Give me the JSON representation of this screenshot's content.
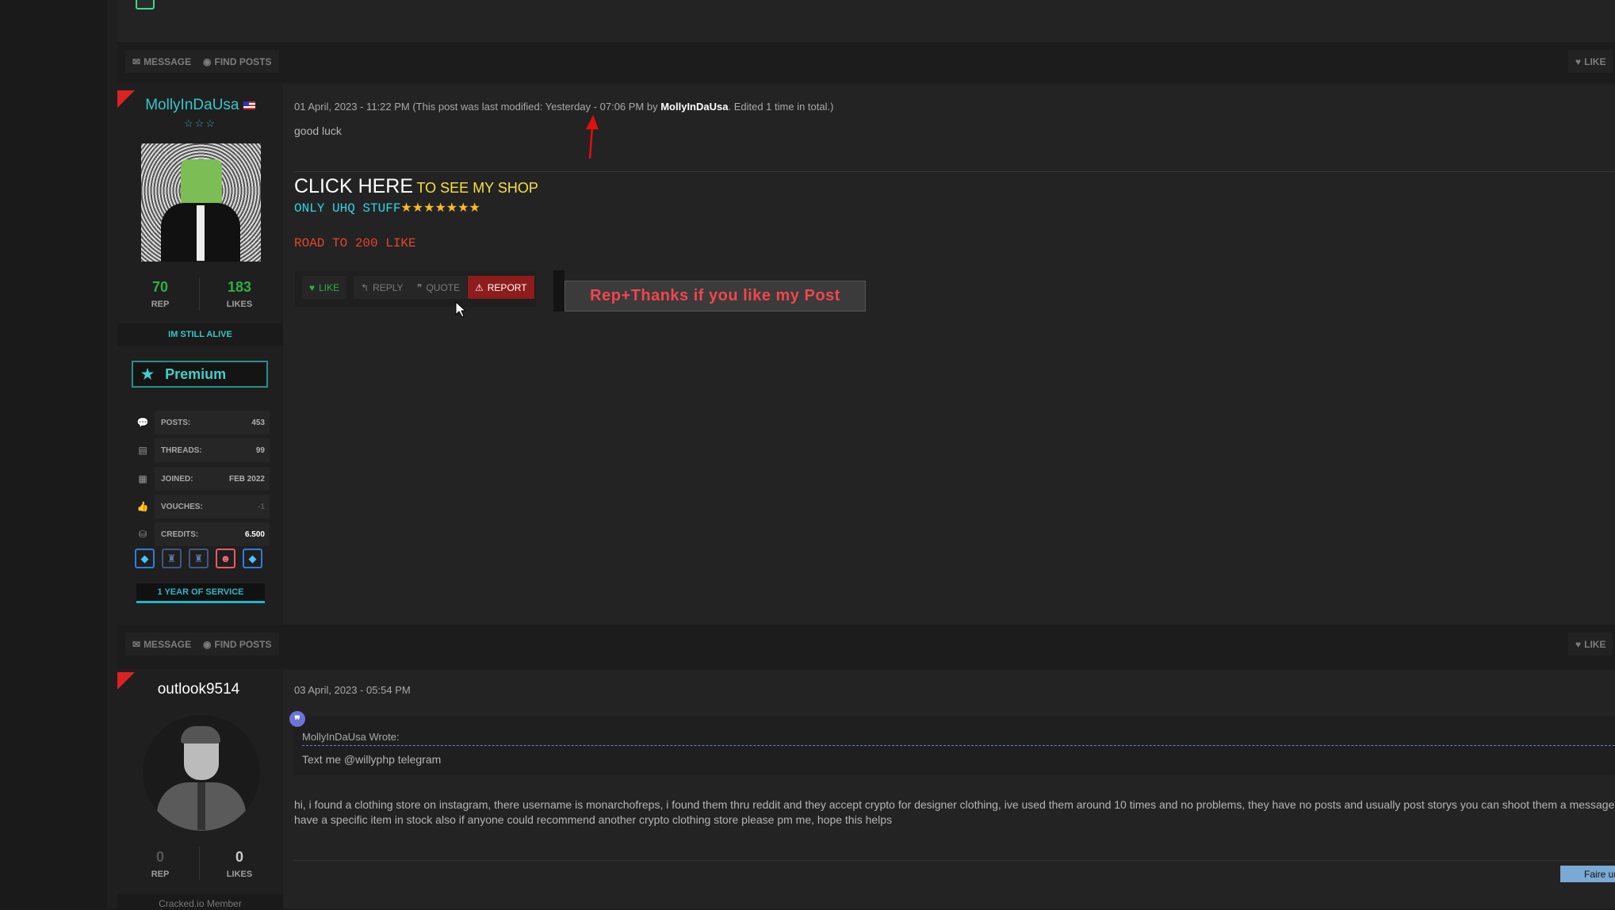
{
  "colors": {
    "accent": "#37c6c9",
    "report": "#8e1c1c",
    "likeGreen": "#2eaf45",
    "premium": "#3fd0c9",
    "fairebtn": "#7aa9d4"
  },
  "post_footer": {
    "message": "MESSAGE",
    "find_posts": "FIND POSTS",
    "like": "LIKE"
  },
  "post1": {
    "username": "MollyInDaUsa",
    "flag": "us-flag-icon",
    "rep": "70",
    "rep_label": "REP",
    "likes": "183",
    "likes_label": "LIKES",
    "title": "IM STILL ALIVE",
    "rank": "Premium",
    "stats": [
      {
        "icon": "comments-icon",
        "key": "POSTS:",
        "value": "453"
      },
      {
        "icon": "book-icon",
        "key": "THREADS:",
        "value": "99"
      },
      {
        "icon": "calendar-icon",
        "key": "JOINED:",
        "value": "FEB 2022"
      },
      {
        "icon": "thumbs-up-icon",
        "key": "VOUCHES:",
        "value": "-1"
      },
      {
        "icon": "coins-icon",
        "key": "CREDITS:",
        "value": "6.500"
      }
    ],
    "service": "1 YEAR OF SERVICE",
    "meta_prefix": "01 April, 2023 - 11:22 PM (This post was last modified: Yesterday - 07:06 PM by ",
    "meta_user": "MollyInDaUsa",
    "meta_suffix": ". Edited 1 time in total.)",
    "body": "good luck",
    "sig_click": "CLICK HERE",
    "sig_shop": "TO SEE MY SHOP",
    "sig_uhq": "ONLY UHQ STUFF",
    "sig_stars": "★★★★★★★",
    "sig_road": "ROAD TO 200 LIKE",
    "actions": {
      "like": "LIKE",
      "reply": "REPLY",
      "quote": "QUOTE",
      "report": "REPORT"
    },
    "banner": "Rep+Thanks if you like my Post"
  },
  "post2": {
    "username": "outlook9514",
    "rep": "0",
    "rep_label": "REP",
    "likes": "0",
    "likes_label": "LIKES",
    "usergroup": "Cracked.io Member",
    "date": "03 April, 2023 - 05:54 PM",
    "quote_author": "MollyInDaUsa Wrote:",
    "quote_text": "Text me @willyphp telegram",
    "body": "hi, i found a clothing store on instagram, there username is monarchofreps, i found them thru reddit and they accept crypto for designer clothing, ive used them around 10 times and no problems, they have no posts and usually post storys you can shoot them a message have a specific item in stock also if anyone could recommend another crypto clothing store please pm me, hope this helps",
    "faire": "Faire un"
  }
}
